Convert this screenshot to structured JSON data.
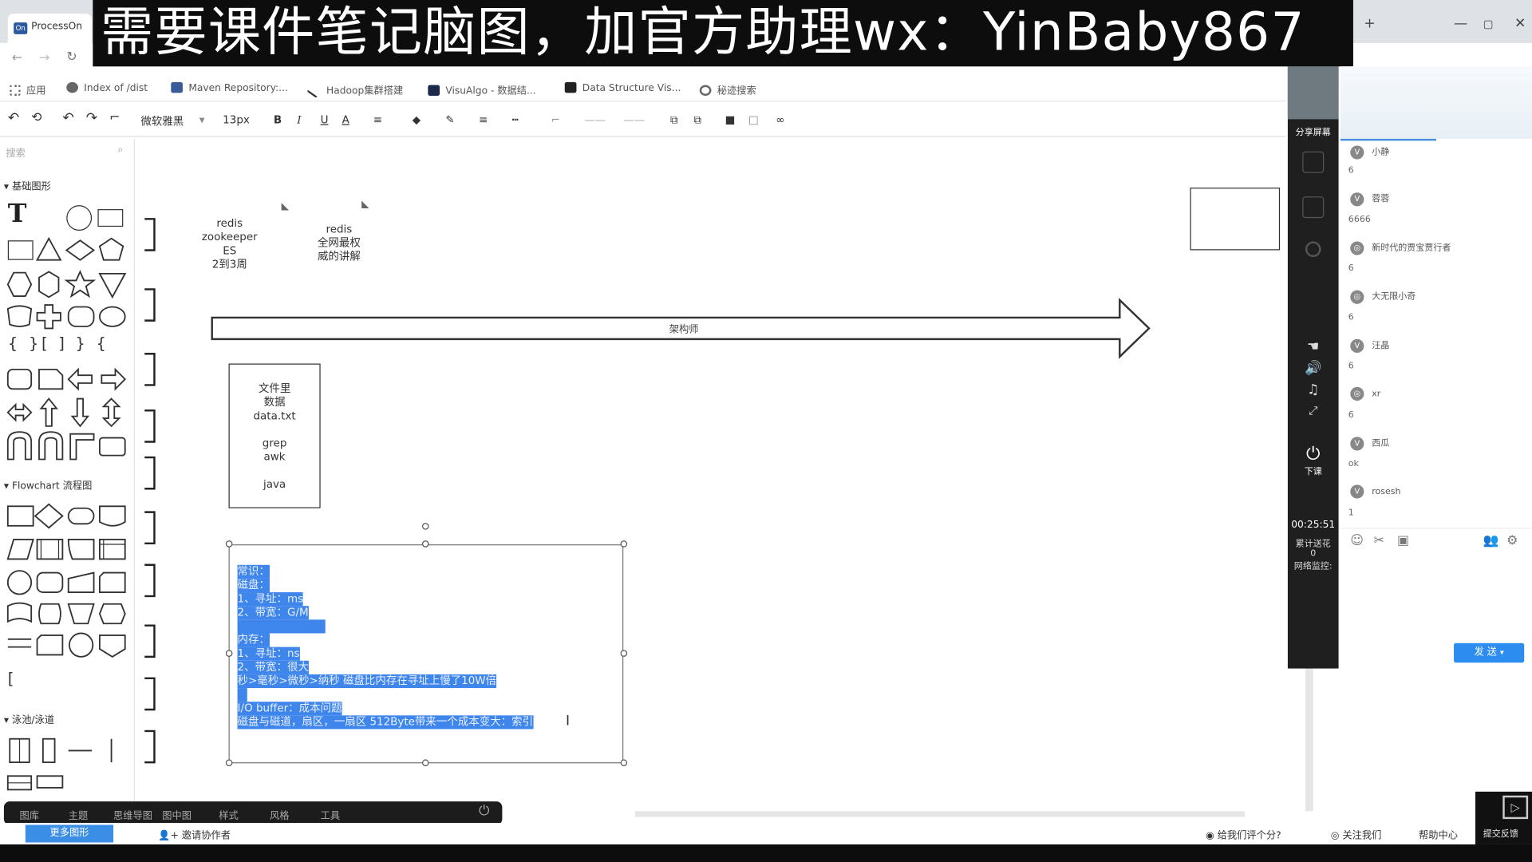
{
  "browser": {
    "tab_title": "ProcessOn",
    "new_tab": "+",
    "window_min": "—",
    "window_max": "▢",
    "window_close": "✕",
    "bookmarks": [
      {
        "label": "应用"
      },
      {
        "label": "Index of /dist"
      },
      {
        "label": "Maven Repository:..."
      },
      {
        "label": "Hadoop集群搭建"
      },
      {
        "label": "VisuAlgo - 数据结..."
      },
      {
        "label": "Data Structure Vis..."
      },
      {
        "label": "秘迹搜索"
      }
    ]
  },
  "banner": {
    "text": "需要课件笔记脑图，加官方助理wx：YinBaby867"
  },
  "toolbar": {
    "font_family": "微软雅黑",
    "font_size": "13px"
  },
  "left_panel": {
    "search_placeholder": "搜索",
    "sections": [
      "基础图形",
      "Flowchart 流程图",
      "泳池/泳道"
    ]
  },
  "canvas": {
    "note1": [
      "redis",
      "zookeeper",
      "ES",
      "2到3周"
    ],
    "note2": [
      "redis",
      "全网最权",
      "威的讲解"
    ],
    "arrow_label": "架构师",
    "file_box": [
      "文件里",
      "数据",
      "data.txt",
      "",
      "grep",
      "awk",
      "",
      "java"
    ],
    "selected_lines": [
      "常识：",
      "磁盘：",
      "1、寻址：ms",
      "2、带宽：G/M",
      "",
      "内存：",
      "1、寻址：ns",
      "2、带宽：很大",
      "秒>毫秒>微秒>纳秒  磁盘比内存在寻址上慢了10W倍",
      "",
      "I/O buffer：成本问题",
      "磁盘与磁道，扇区，一扇区 512Byte带来一个成本变大：索引"
    ]
  },
  "bottom_bar": {
    "items": [
      "图库",
      "主题",
      "思维导图",
      "图中图",
      "样式",
      "风格",
      "工具"
    ]
  },
  "footer": {
    "left_button": "更多图形",
    "invite": "邀请协作者",
    "rate": "给我们评个分?",
    "follow": "关注我们",
    "help": "帮助中心",
    "feedback": "提交反馈"
  },
  "live_panel": {
    "share": "分享屏幕",
    "class_end": "下课",
    "timer": "00:25:51",
    "stat1": "累计送花",
    "stat1_val": "0",
    "stat2": "网络监控:"
  },
  "chat": {
    "messages": [
      {
        "avatar": "V",
        "name": "小静",
        "value": "6"
      },
      {
        "avatar": "V",
        "name": "蓉蓉",
        "value": "6666"
      },
      {
        "avatar": "◎",
        "name": "新时代的贾宝贾行者",
        "value": "6"
      },
      {
        "avatar": "◎",
        "name": "大无限小奇",
        "value": "6"
      },
      {
        "avatar": "V",
        "name": "汪晶",
        "value": "6"
      },
      {
        "avatar": "◎",
        "name": "xr",
        "value": "6"
      },
      {
        "avatar": "V",
        "name": "西瓜",
        "value": "ok"
      },
      {
        "avatar": "V",
        "name": "rosesh",
        "value": "1"
      }
    ],
    "send_label": "发 送"
  },
  "colors": {
    "selection": "#3f86ec",
    "send": "#2d8cf0",
    "banner_bg": "#0d0d0d"
  }
}
